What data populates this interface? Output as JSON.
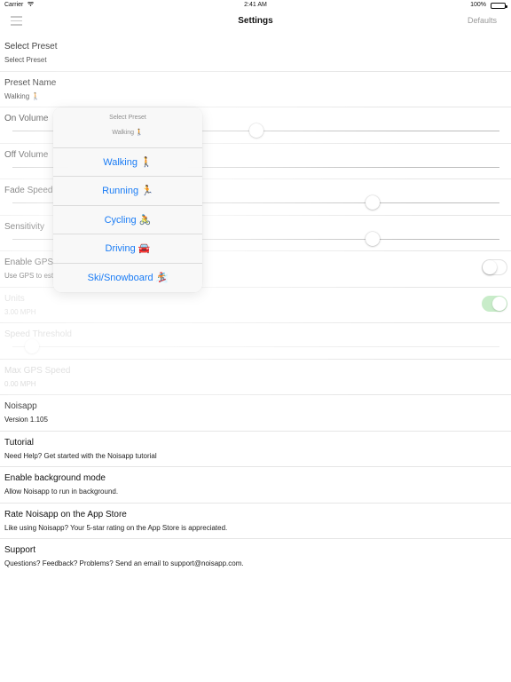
{
  "status_bar": {
    "carrier": "Carrier",
    "time": "2:41 AM",
    "battery_percent": "100%"
  },
  "nav_bar": {
    "title": "Settings",
    "defaults_label": "Defaults",
    "menu_icon": "hamburger-menu-icon"
  },
  "settings": {
    "select_preset": {
      "title": "Select Preset",
      "value": "Select Preset"
    },
    "preset_name": {
      "title": "Preset Name",
      "value": "Walking 🚶"
    },
    "on_volume": {
      "title": "On Volume",
      "level": 0.5
    },
    "off_volume": {
      "title": "Off Volume",
      "level": 0.0
    },
    "fade_speed": {
      "title": "Fade Speed",
      "level": 0.74
    },
    "sensitivity": {
      "title": "Sensitivity",
      "level": 0.74
    },
    "enable_gps": {
      "title": "Enable GPS r",
      "subtitle": "Use GPS to est",
      "enabled": false
    },
    "units": {
      "title": "Units",
      "value": "3.00 MPH",
      "enabled": true
    },
    "speed_threshold": {
      "title": "Speed Threshold",
      "level": 0.04
    },
    "max_gps_speed": {
      "title": "Max GPS Speed",
      "value": "0.00 MPH"
    },
    "noisapp": {
      "title": "Noisapp",
      "subtitle": "Version 1.105"
    },
    "tutorial": {
      "title": "Tutorial",
      "subtitle": "Need Help? Get started with the Noisapp tutorial"
    },
    "background_mode": {
      "title": "Enable background mode",
      "subtitle": "Allow Noisapp to run in background."
    },
    "rate": {
      "title": "Rate Noisapp on the App Store",
      "subtitle": "Like using Noisapp? Your 5-star rating on the App Store is appreciated."
    },
    "support": {
      "title": "Support",
      "subtitle": "Questions? Feedback? Problems? Send an email to support@noisapp.com."
    }
  },
  "preset_popover": {
    "title": "Select Preset",
    "current": "Walking 🚶",
    "options": [
      "Walking 🚶",
      "Running 🏃",
      "Cycling 🚴",
      "Driving 🚘",
      "Ski/Snowboard 🏂"
    ]
  },
  "colors": {
    "accent": "#1a7cf5",
    "toggle_on": "#c8ecc9",
    "disabled_text": "#cfcfcf"
  }
}
